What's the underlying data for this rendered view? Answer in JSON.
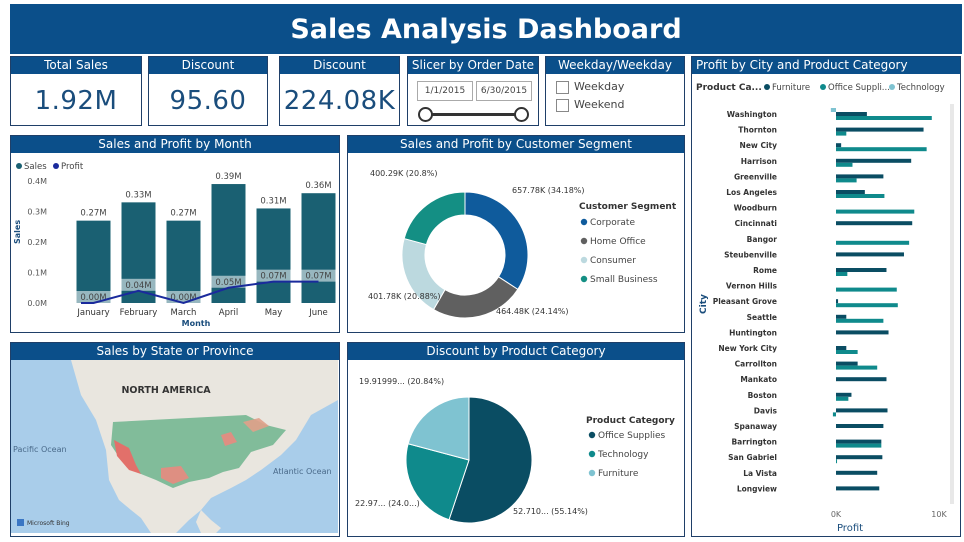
{
  "dashboard": {
    "title": "Sales Analysis Dashboard"
  },
  "kpis": [
    {
      "title": "Total Sales",
      "value": "1.92M"
    },
    {
      "title": "Discount",
      "value": "95.60"
    },
    {
      "title": "Discount",
      "value": "224.08K"
    }
  ],
  "slicer_date": {
    "title": "Slicer by Order Date",
    "start": "1/1/2015",
    "end": "6/30/2015"
  },
  "slicer_week": {
    "title": "Weekday/Weekday",
    "options": [
      "Weekday",
      "Weekend"
    ]
  },
  "colors": {
    "header": "#0b4f8a",
    "sales": "#1a6072",
    "profit": "#1a2a9c",
    "corporate": "#0f5b9c",
    "home_office": "#606060",
    "consumer": "#bcd9df",
    "small_business": "#148f84",
    "office_supplies": "#0a4d63",
    "technology": "#0f8a8c",
    "furniture": "#7fc3d1"
  },
  "month_chart": {
    "title": "Sales and Profit by Month",
    "legend": [
      "Sales",
      "Profit"
    ],
    "ylabel": "Sales",
    "xlabel": "Month",
    "yticks": [
      "0.4M",
      "0.3M",
      "0.2M",
      "0.1M",
      "0.0M"
    ],
    "chart_data": {
      "type": "bar",
      "categories": [
        "January",
        "February",
        "March",
        "April",
        "May",
        "June"
      ],
      "series": [
        {
          "name": "Sales",
          "values": [
            0.27,
            0.33,
            0.27,
            0.39,
            0.31,
            0.36
          ],
          "labels": [
            "0.27M",
            "0.33M",
            "0.27M",
            "0.39M",
            "0.31M",
            "0.36M"
          ]
        },
        {
          "name": "Profit",
          "values": [
            0.0,
            0.04,
            0.0,
            0.05,
            0.07,
            0.07
          ],
          "labels": [
            "0.00M",
            "0.04M",
            "0.00M",
            "0.05M",
            "0.07M",
            "0.07M"
          ]
        }
      ],
      "ylim": [
        0,
        0.4
      ]
    }
  },
  "segment_chart": {
    "title": "Sales and Profit by Customer Segment",
    "legend_title": "Customer Segment",
    "chart_data": {
      "type": "pie",
      "labels": [
        "Corporate",
        "Home Office",
        "Consumer",
        "Small Business"
      ],
      "values": [
        657.78,
        464.48,
        401.78,
        400.29
      ],
      "data_labels": [
        "657.78K (34.18%)",
        "464.48K (24.14%)",
        "401.78K (20.88%)",
        "400.29K (20.8%)"
      ]
    }
  },
  "map": {
    "title": "Sales by State or Province",
    "label_na": "NORTH AMERICA",
    "label_pacific": "Pacific Ocean",
    "label_atlantic": "Atlantic Ocean",
    "brand": "Microsoft Bing"
  },
  "discount_chart": {
    "title": "Discount by Product Category",
    "legend_title": "Product Category",
    "chart_data": {
      "type": "pie",
      "labels": [
        "Office Supplies",
        "Technology",
        "Furniture"
      ],
      "values": [
        55.14,
        24.02,
        20.84
      ],
      "data_labels": [
        "52.710... (55.14%)",
        "22.97... (24.0...)",
        "19.91999... (20.84%)"
      ]
    }
  },
  "city_chart": {
    "title": "Profit by City and Product Category",
    "legend_title": "Product Ca...",
    "legend": [
      "Furniture",
      "Office Suppli...",
      "Technology"
    ],
    "ylabel": "City",
    "xlabel": "Profit",
    "xticks": [
      "0K",
      "10K"
    ],
    "chart_data": {
      "type": "bar",
      "categories": [
        "Washington",
        "Thornton",
        "New City",
        "Harrison",
        "Greenville",
        "Los Angeles",
        "Woodburn",
        "Cincinnati",
        "Bangor",
        "Steubenville",
        "Rome",
        "Vernon Hills",
        "Pleasant Grove",
        "Seattle",
        "Huntington",
        "New York City",
        "Carrollton",
        "Mankato",
        "Boston",
        "Davis",
        "Spanaway",
        "Barrington",
        "San Gabriel",
        "La Vista",
        "Longview"
      ],
      "series": [
        {
          "name": "Furniture",
          "values": [
            -0.5,
            0,
            0,
            0,
            0,
            0,
            0,
            0,
            0,
            0,
            0,
            0,
            0,
            0,
            0,
            0,
            0,
            0,
            0,
            0,
            0,
            0,
            0,
            0,
            0
          ]
        },
        {
          "name": "Office Suppli...",
          "values": [
            3.0,
            8.5,
            0.5,
            7.3,
            4.6,
            2.8,
            0,
            7.4,
            0,
            6.6,
            4.9,
            0,
            0.2,
            1.0,
            5.1,
            1.0,
            2.1,
            4.9,
            1.5,
            5.0,
            4.6,
            4.4,
            4.5,
            4.0,
            4.2
          ]
        },
        {
          "name": "Technology",
          "values": [
            9.3,
            1.0,
            8.8,
            1.6,
            2.0,
            4.7,
            7.6,
            0,
            7.1,
            0,
            1.1,
            5.9,
            6.0,
            4.6,
            0,
            2.1,
            4.0,
            0,
            1.2,
            -0.3,
            0,
            4.4,
            0.1,
            0,
            0
          ]
        }
      ],
      "xlim": [
        -0.5,
        10
      ]
    }
  }
}
